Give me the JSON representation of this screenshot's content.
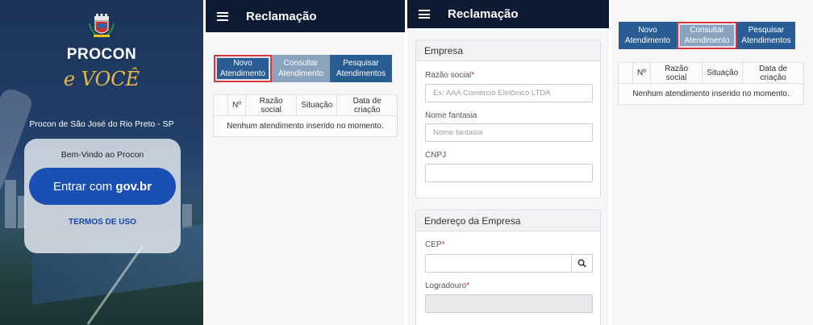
{
  "login": {
    "brand": "PROCON",
    "slogan": "e VOCÊ",
    "city": "Procon de São José do Rio Preto - SP",
    "welcome": "Bem-Vindo ao Procon",
    "gov_button_prefix": "Entrar com",
    "gov_button_brand": "gov.br",
    "terms": "TERMOS DE USO"
  },
  "list_view": {
    "title": "Reclamação",
    "tabs": [
      {
        "line1": "Novo",
        "line2": "Atendimento"
      },
      {
        "line1": "Consultar",
        "line2": "Atendimento"
      },
      {
        "line1": "Pesquisar",
        "line2": "Atendimentos"
      }
    ],
    "columns": [
      "Nº",
      "Razão social",
      "Situação",
      "Data de criação"
    ],
    "empty_message": "Nenhum atendimento inserido no momento."
  },
  "form_view": {
    "title": "Reclamação",
    "company_section": "Empresa",
    "fields": {
      "razao_social_label": "Razão social",
      "razao_social_placeholder": "Ex: AAA Comércio Eletônico LTDA",
      "nome_fantasia_label": "Nome fantasia",
      "nome_fantasia_placeholder": "Nome fantasia",
      "cnpj_label": "CNPJ"
    },
    "address_section": "Endereço da Empresa",
    "address_fields": {
      "cep_label": "CEP",
      "logradouro_label": "Logradouro"
    },
    "required_mark": "*"
  },
  "colors": {
    "appbar": "#0c1b33",
    "button_dark": "#2a5d94",
    "button_light": "#8aa4c0",
    "highlight": "#d8353a",
    "gov_blue": "#1a4fb3",
    "slogan_gold": "#e8b94a"
  }
}
